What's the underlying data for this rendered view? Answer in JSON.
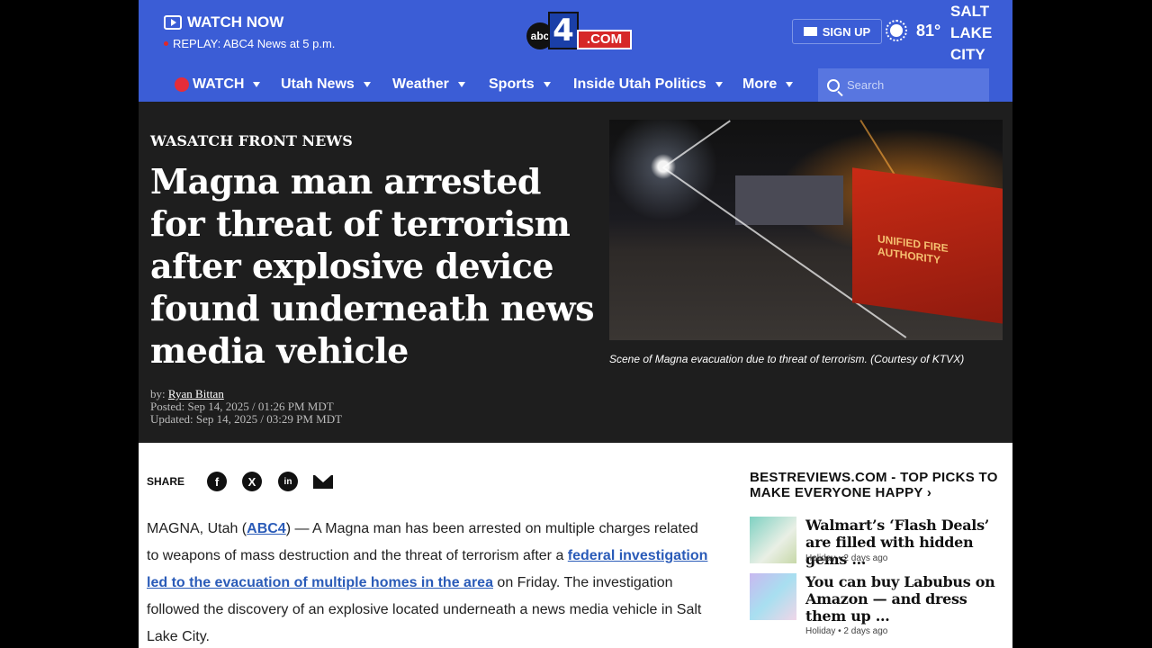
{
  "header": {
    "watch_now": "WATCH NOW",
    "replay": "REPLAY: ABC4 News at 5 p.m.",
    "logo": {
      "circle": "abc",
      "number": "4",
      "domain": ".COM"
    },
    "signup": "SIGN UP",
    "temperature": "81°",
    "city_line1": "SALT",
    "city_line2": "LAKE",
    "city_line3": "CITY"
  },
  "nav": {
    "items": [
      {
        "label": "WATCH"
      },
      {
        "label": "Utah News"
      },
      {
        "label": "Weather"
      },
      {
        "label": "Sports"
      },
      {
        "label": "Inside Utah Politics"
      },
      {
        "label": "More"
      }
    ],
    "search_placeholder": "Search"
  },
  "article": {
    "kicker": "WASATCH FRONT NEWS",
    "headline": "Magna man arrested for threat of terrorism after explosive device found underneath news media vehicle",
    "by_prefix": "by:",
    "author": "Ryan Bittan",
    "posted": "Posted: Sep 14, 2025 / 01:26 PM MDT",
    "updated": "Updated: Sep 14, 2025 / 03:29 PM MDT",
    "photo_text": "UNIFIED FIRE AUTHORITY",
    "caption": "Scene of Magna evacuation due to threat of terrorism. (Courtesy of KTVX)",
    "share_label": "SHARE",
    "share_icons": [
      "facebook-icon",
      "x-icon",
      "linkedin-icon",
      "email-icon"
    ],
    "body": {
      "p1_a": "MAGNA, Utah (",
      "p1_link1": "ABC4",
      "p1_b": ") — A Magna man has been arrested on multiple charges related to weapons of mass destruction and the threat of terrorism after a ",
      "p1_link2": "federal investigation led to the evacuation of multiple homes in the area",
      "p1_c": " on Friday. The investigation followed the discovery of an explosive located underneath a news media vehicle in Salt Lake City."
    }
  },
  "sidebar": {
    "title": "BESTREVIEWS.COM - TOP PICKS TO MAKE EVERYONE HAPPY ›",
    "cards": [
      {
        "title": "Walmart’s ‘Flash Deals’ are filled with hidden gems …",
        "category": "Holiday",
        "age": "2 days ago"
      },
      {
        "title": "You can buy Labubus on Amazon — and dress them up …",
        "category": "Holiday",
        "age": "2 days ago"
      }
    ]
  },
  "colors": {
    "brand_blue": "#3b5dd6",
    "hero_bg": "#1e1e1e",
    "link": "#2a5bb8",
    "live_red": "#e52d3a"
  }
}
